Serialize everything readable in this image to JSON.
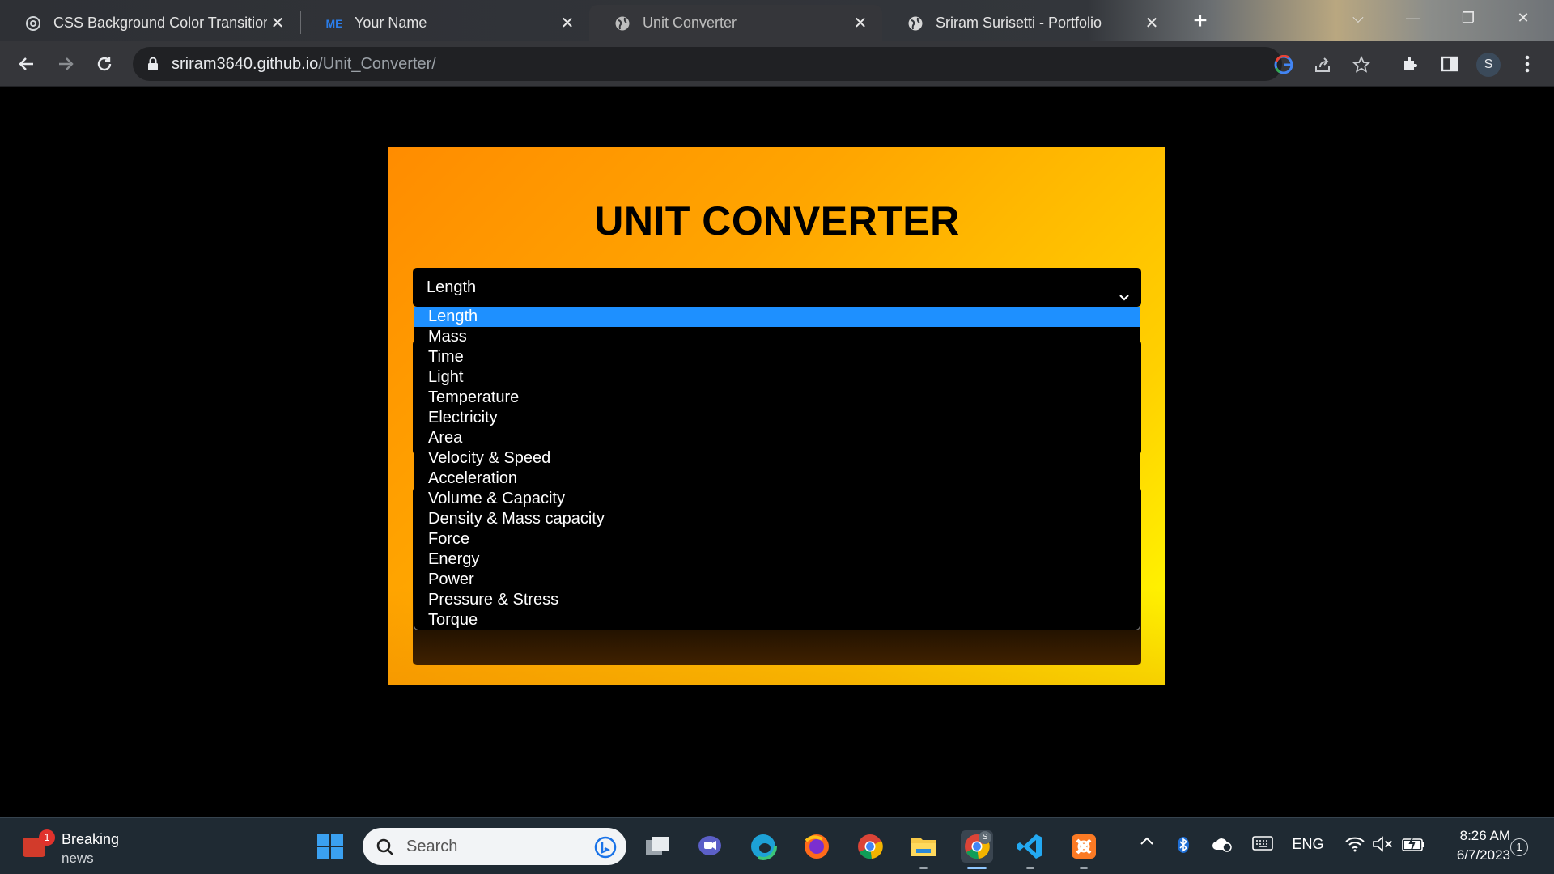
{
  "browser": {
    "tabs": [
      {
        "title": "CSS Background Color Transition",
        "favicon": "chatgpt-icon",
        "active": false
      },
      {
        "title": "Your Name",
        "favicon": "me-icon",
        "favicon_text": "ME",
        "active": false
      },
      {
        "title": "Unit Converter",
        "favicon": "globe-icon",
        "active": true
      },
      {
        "title": "Sriram Surisetti - Portfolio",
        "favicon": "globe-icon",
        "active": false
      }
    ],
    "url_host": "sriram3640.github.io",
    "url_path": "/Unit_Converter/",
    "profile_initial": "S"
  },
  "page": {
    "title": "UNIT CONVERTER",
    "selected_category": "Length",
    "options": [
      "Length",
      "Mass",
      "Time",
      "Light",
      "Temperature",
      "Electricity",
      "Area",
      "Velocity & Speed",
      "Acceleration",
      "Volume & Capacity",
      "Density & Mass capacity",
      "Force",
      "Energy",
      "Power",
      "Pressure & Stress",
      "Torque"
    ],
    "colors": {
      "gradient_start": "#ff8c00",
      "gradient_end": "#ffff00",
      "highlight": "#1e90ff"
    }
  },
  "taskbar": {
    "news_title": "Breaking",
    "news_subtitle": "news",
    "news_badge": "1",
    "search_placeholder": "Search",
    "language": "ENG",
    "time": "8:26 AM",
    "date": "6/7/2023",
    "notifications": "1",
    "chrome_badge": "S"
  }
}
